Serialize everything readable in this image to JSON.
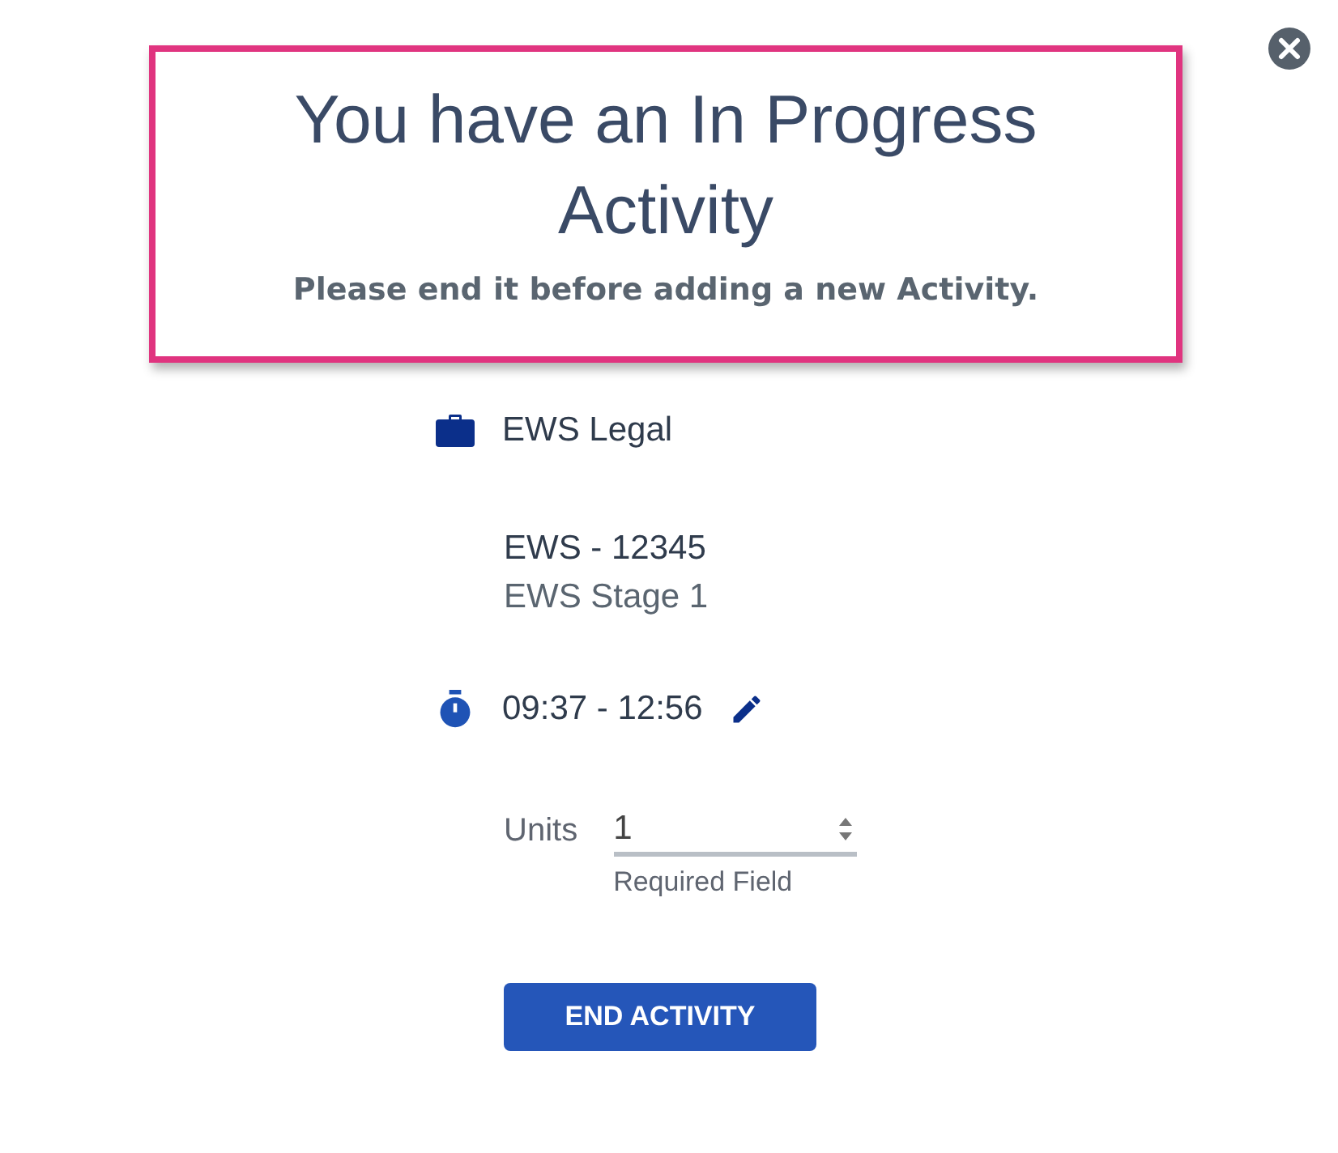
{
  "title": "You have an In Progress Activity",
  "subtitle": "Please end it before adding a new Activity.",
  "client": "EWS Legal",
  "matter": {
    "number": "EWS - 12345",
    "stage": "EWS Stage 1"
  },
  "time_range": "09:37 - 12:56",
  "units": {
    "label": "Units",
    "value": "1",
    "hint": "Required Field"
  },
  "button": "END ACTIVITY"
}
